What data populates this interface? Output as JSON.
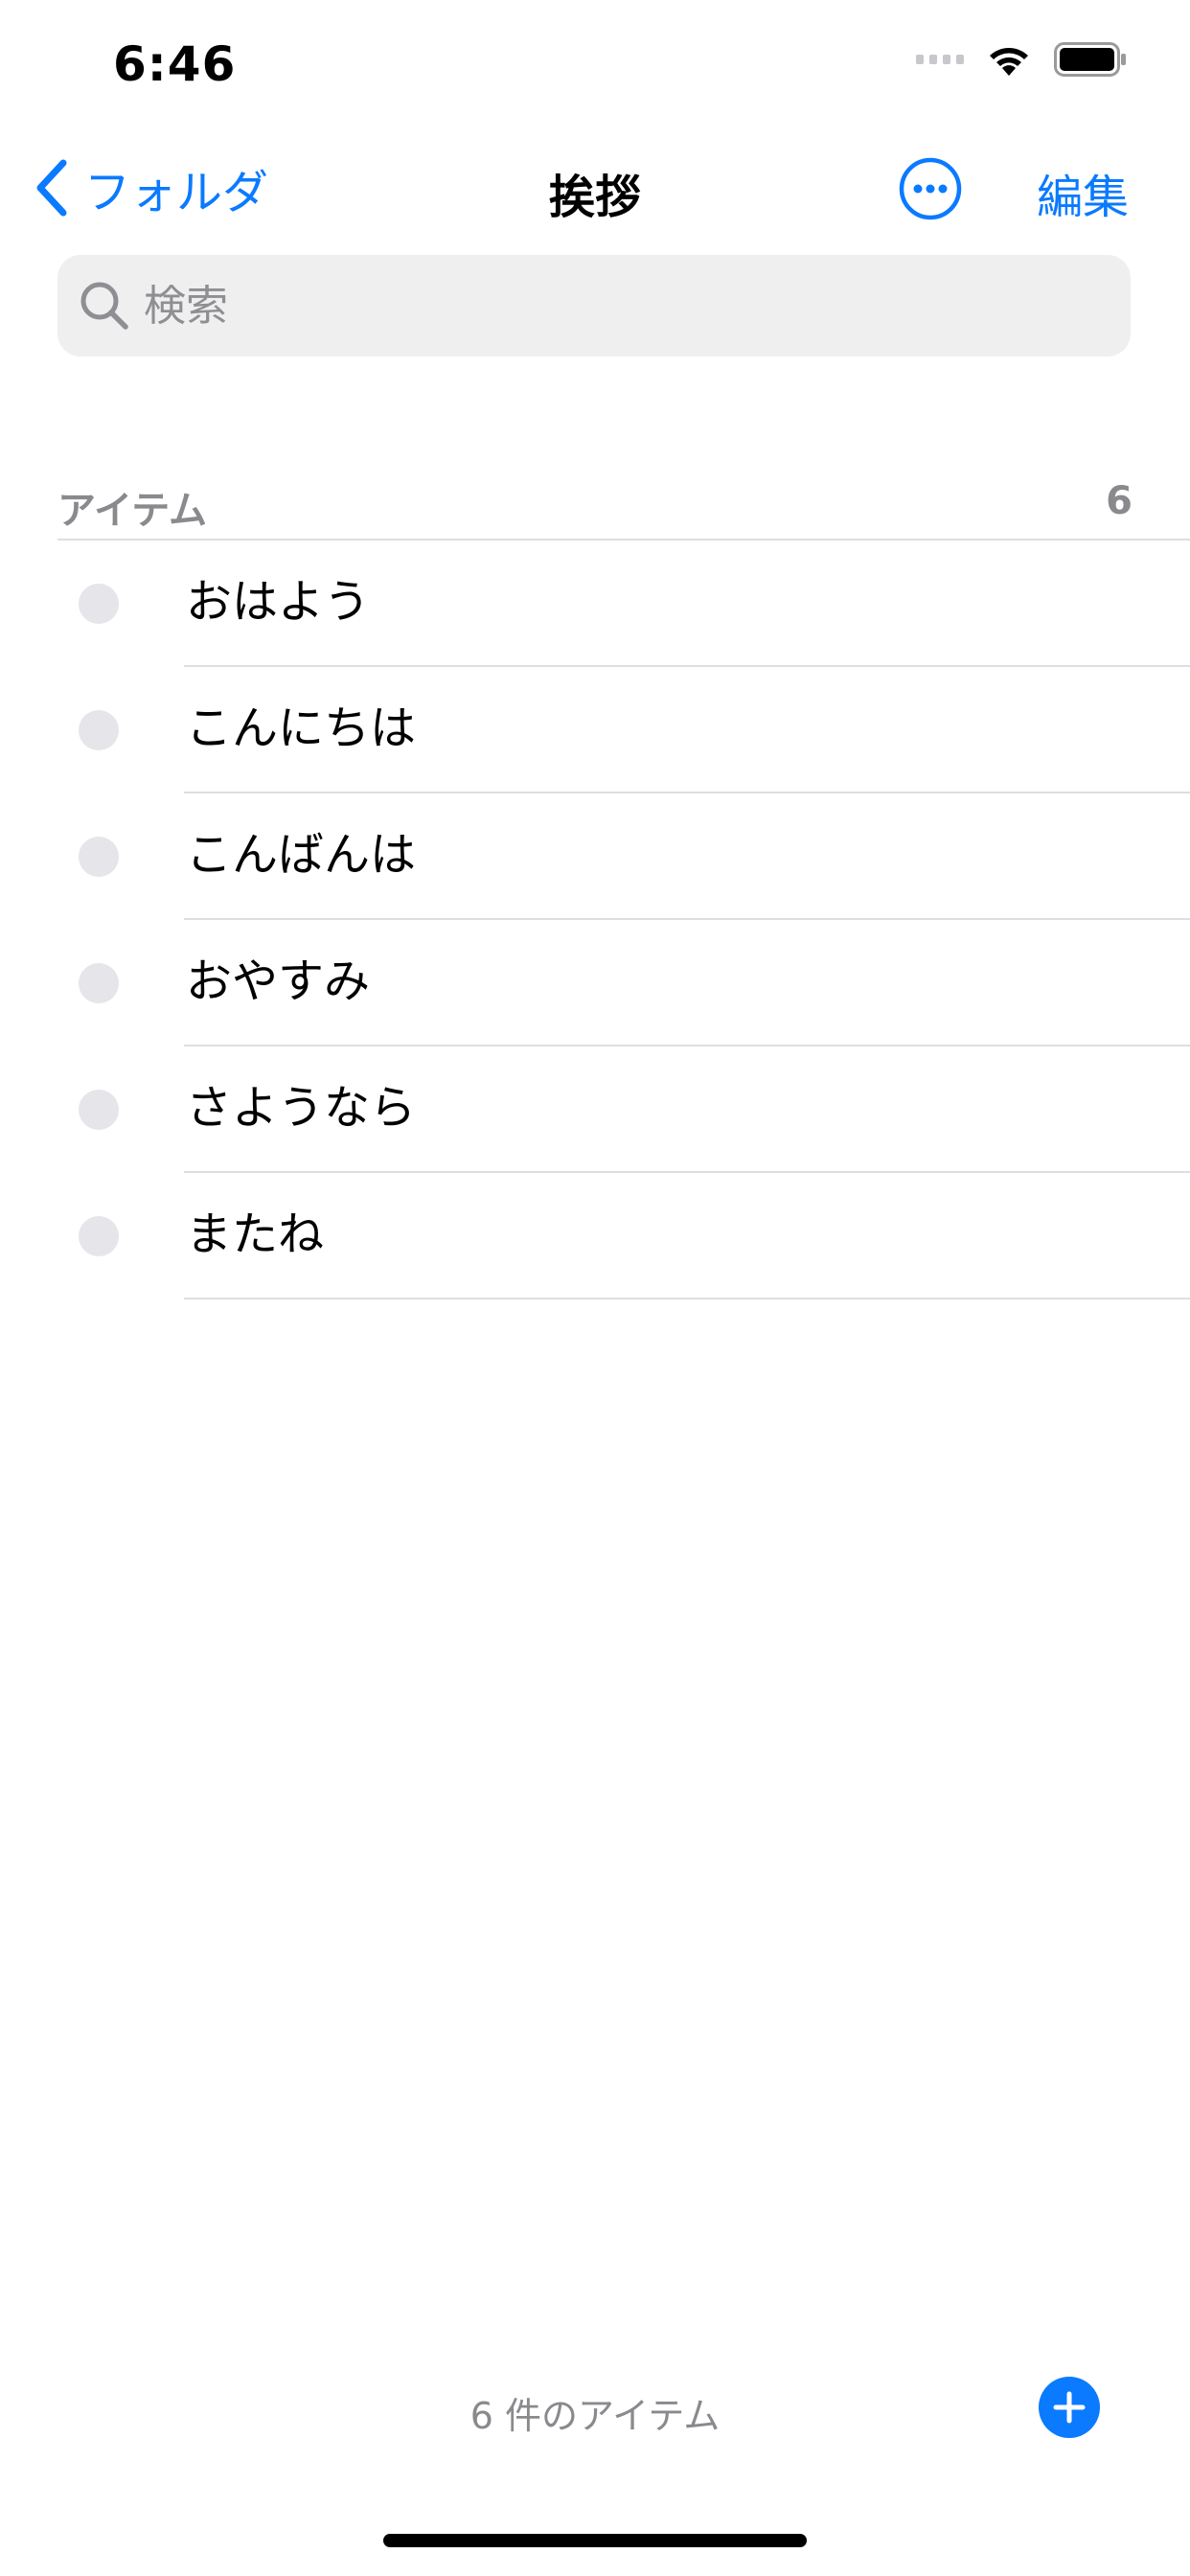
{
  "status_bar": {
    "time": "6:46"
  },
  "nav": {
    "back_label": "フォルダ",
    "title": "挨拶",
    "edit_label": "編集"
  },
  "search": {
    "placeholder": "検索"
  },
  "section": {
    "label": "アイテム",
    "count": "6"
  },
  "items": [
    {
      "label": "おはよう"
    },
    {
      "label": "こんにちは"
    },
    {
      "label": "こんばんは"
    },
    {
      "label": "おやすみ"
    },
    {
      "label": "さようなら"
    },
    {
      "label": "またね"
    }
  ],
  "footer": {
    "count_label": "6 件のアイテム"
  },
  "colors": {
    "accent": "#0a7aff",
    "secondary_text": "#8a8a8e",
    "separator": "#dedee2",
    "checkbox": "#e5e5ea"
  },
  "icons": [
    "back-chevron-icon",
    "more-icon",
    "search-icon",
    "wifi-icon",
    "battery-icon",
    "cellular-icon",
    "plus-icon"
  ]
}
